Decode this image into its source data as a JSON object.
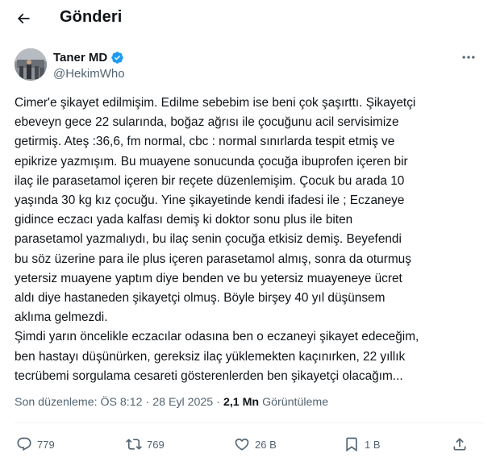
{
  "header": {
    "back_icon": "arrow-left-icon",
    "title": "Gönderi"
  },
  "author": {
    "name": "Taner MD",
    "handle": "@HekimWho",
    "verified_color": "#1d9bf0"
  },
  "post": {
    "lines": [
      "Cimer'e şikayet edilmişim. Edilme sebebim ise beni çok şaşırttı. Şikayetçi",
      "ebeveyn gece 22 sularında, boğaz ağrısı ile çocuğunu acil servisimize",
      "getirmiş. Ateş :36,6, fm normal, cbc : normal sınırlarda tespit etmiş ve",
      "epikrize yazmışım. Bu muayene sonucunda çocuğa ibuprofen içeren bir",
      "ilaç ile parasetamol içeren bir reçete düzenlemişim. Çocuk bu arada 10",
      "yaşında 30 kg kız çocuğu. Yine şikayetinde kendi ifadesi ile ; Eczaneye",
      "gidince eczacı yada kalfası demiş ki doktor sonu plus ile biten",
      "parasetamol yazmalıydı, bu ilaç senin çocuğa etkisiz demiş. Beyefendi",
      "bu söz üzerine para ile plus içeren parasetamol almış, sonra da oturmuş",
      "yetersiz muayene yaptım diye benden ve bu yetersiz muayeneye ücret",
      "aldı diye hastaneden şikayetçi olmuş. Böyle birşey 40 yıl düşünsem",
      "aklıma gelmezdi.",
      "Şimdi yarın öncelikle eczacılar odasına ben o eczaneyi şikayet edeceğim,",
      "ben hastayı düşünürken, gereksiz ilaç yüklemekten kaçınırken, 22 yıllık",
      "tecrübemi sorgulama cesareti gösterenlerden ben şikayetçi olacağım..."
    ]
  },
  "meta": {
    "edited_label": "Son düzenleme: ÖS 8:12",
    "separator": "·",
    "date": "28 Eyl 2025",
    "views_count": "2,1 Mn",
    "views_label": "Görüntüleme"
  },
  "actions": {
    "replies": "779",
    "reposts": "769",
    "likes": "26 B",
    "bookmarks": "1 B"
  },
  "colors": {
    "text": "#0f1419",
    "secondary": "#536471",
    "divider": "#eff3f4",
    "accent": "#1d9bf0"
  }
}
